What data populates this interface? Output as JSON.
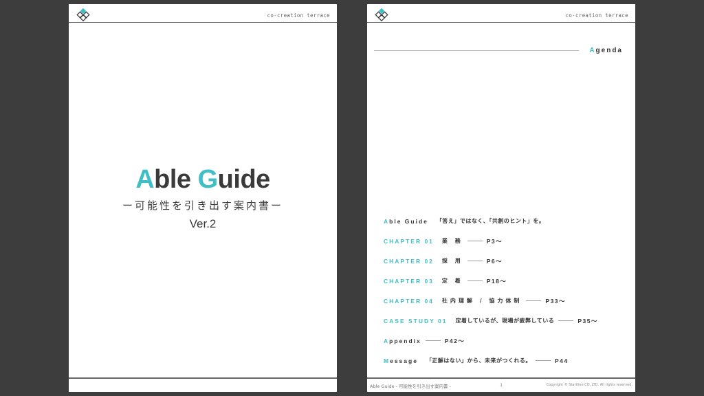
{
  "brand": "co-creation terrace",
  "colors": {
    "accent": "#3fbfc5",
    "text": "#3a3a3a",
    "background": "#3d3d3d"
  },
  "icons": {
    "logo": "diamond-lattice-logo"
  },
  "cover": {
    "title_a": "A",
    "title_b": "ble ",
    "title_c": "G",
    "title_d": "uide",
    "subtitle": "ー可能性を引き出す案内書ー",
    "version": "Ver.2"
  },
  "agenda": {
    "heading_first": "A",
    "heading_rest": "genda",
    "items": [
      {
        "label_first": "A",
        "label_rest": "ble Guide",
        "title": "「答え」ではなく、「共創のヒント」を。",
        "page": ""
      },
      {
        "label": "CHAPTER 01",
        "title": "業 務",
        "page": "P3～"
      },
      {
        "label": "CHAPTER 02",
        "title": "採 用",
        "page": "P6～"
      },
      {
        "label": "CHAPTER 03",
        "title": "定 着",
        "page": "P18～"
      },
      {
        "label": "CHAPTER 04",
        "title": "社内理解 / 協力体制",
        "page": "P33～"
      },
      {
        "label": "CASE STUDY 01",
        "title": "定着しているが、現場が疲弊している",
        "page": "P35～"
      },
      {
        "label_first": "A",
        "label_rest": "ppendix",
        "title": "",
        "page": "P42～"
      },
      {
        "label_first": "M",
        "label_rest": "essage",
        "title": "「正解はない」から、未来がつくれる。",
        "page": "P44"
      }
    ]
  },
  "footer": {
    "left": "Able Guide - 可能性を引き出す案内書 -",
    "page_number": "1",
    "copyright": "Copyright © Startline CO.,LTD. All rights reserved."
  }
}
